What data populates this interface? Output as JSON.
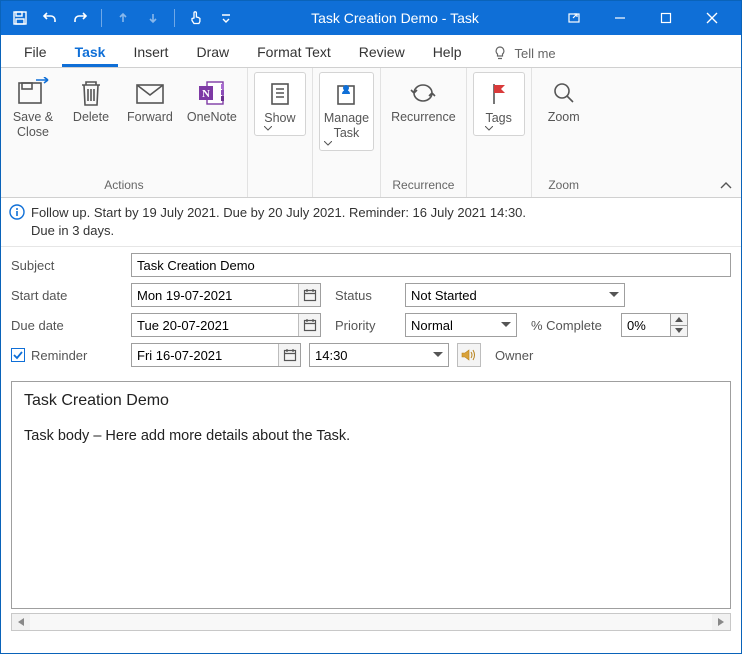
{
  "window": {
    "title": "Task Creation Demo  -  Task"
  },
  "menu": {
    "file": "File",
    "task": "Task",
    "insert": "Insert",
    "draw": "Draw",
    "format": "Format Text",
    "review": "Review",
    "help": "Help",
    "tellme": "Tell me"
  },
  "ribbon": {
    "saveclose": "Save &\nClose",
    "delete": "Delete",
    "forward": "Forward",
    "onenote": "OneNote",
    "show": "Show",
    "managetask": "Manage\nTask",
    "recurrence": "Recurrence",
    "tags": "Tags",
    "zoom": "Zoom",
    "group_actions": "Actions",
    "group_recurrence": "Recurrence",
    "group_zoom": "Zoom"
  },
  "info": {
    "line1": "Follow up.  Start by 19 July 2021.  Due by 20 July 2021.  Reminder: 16 July 2021 14:30.",
    "line2": "Due in 3 days."
  },
  "labels": {
    "subject": "Subject",
    "startdate": "Start date",
    "duedate": "Due date",
    "status": "Status",
    "priority": "Priority",
    "pctcomplete": "% Complete",
    "reminder": "Reminder",
    "owner": "Owner"
  },
  "values": {
    "subject": "Task Creation Demo",
    "startdate": "Mon 19-07-2021",
    "duedate": "Tue 20-07-2021",
    "status": "Not Started",
    "priority": "Normal",
    "pctcomplete": "0%",
    "reminder_date": "Fri 16-07-2021",
    "reminder_time": "14:30"
  },
  "body": {
    "title": "Task Creation Demo",
    "text": "Task body – Here add more details about the Task."
  }
}
